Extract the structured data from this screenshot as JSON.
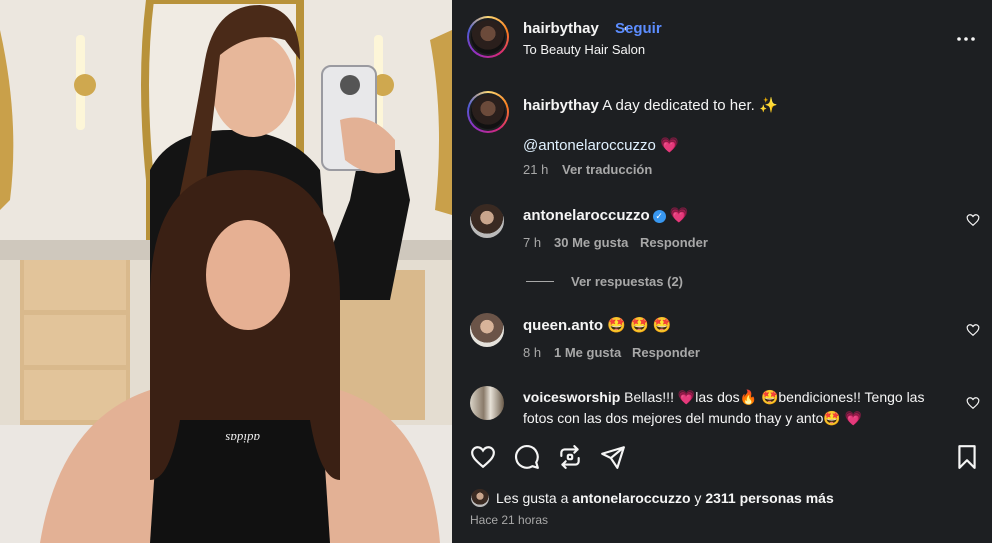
{
  "post": {
    "username": "hairbythay",
    "separator": "•",
    "follow_label": "Seguir",
    "location": "To Beauty Hair Salon",
    "more_icon": "more-horizontal-icon"
  },
  "caption": {
    "username": "hairbythay",
    "text": "A day dedicated to her. ✨",
    "mention": "@antonelaroccuzzo",
    "emoji": "💗",
    "time": "21 h",
    "translate": "Ver traducción"
  },
  "comments": [
    {
      "username": "antonelaroccuzzo",
      "verified": true,
      "text": "💗",
      "time": "7 h",
      "likes": "30 Me gusta",
      "reply": "Responder",
      "view_replies": "Ver respuestas (2)"
    },
    {
      "username": "queen.anto",
      "text": "🤩 🤩 🤩",
      "time": "8 h",
      "likes": "1 Me gusta",
      "reply": "Responder"
    },
    {
      "username": "voicesworship",
      "text": "Bellas!!! 💗las dos🔥 🤩bendiciones!! Tengo las fotos con las dos mejores del mundo thay y anto🤩 💗"
    }
  ],
  "actions": {
    "like": "heart-icon",
    "comment": "comment-icon",
    "repost": "repost-icon",
    "share": "send-icon",
    "save": "bookmark-icon"
  },
  "likes": {
    "prefix": "Les gusta a",
    "user": "antonelaroccuzzo",
    "connector": "y",
    "others": "2311 personas más",
    "timestamp": "Hace 21 horas"
  }
}
